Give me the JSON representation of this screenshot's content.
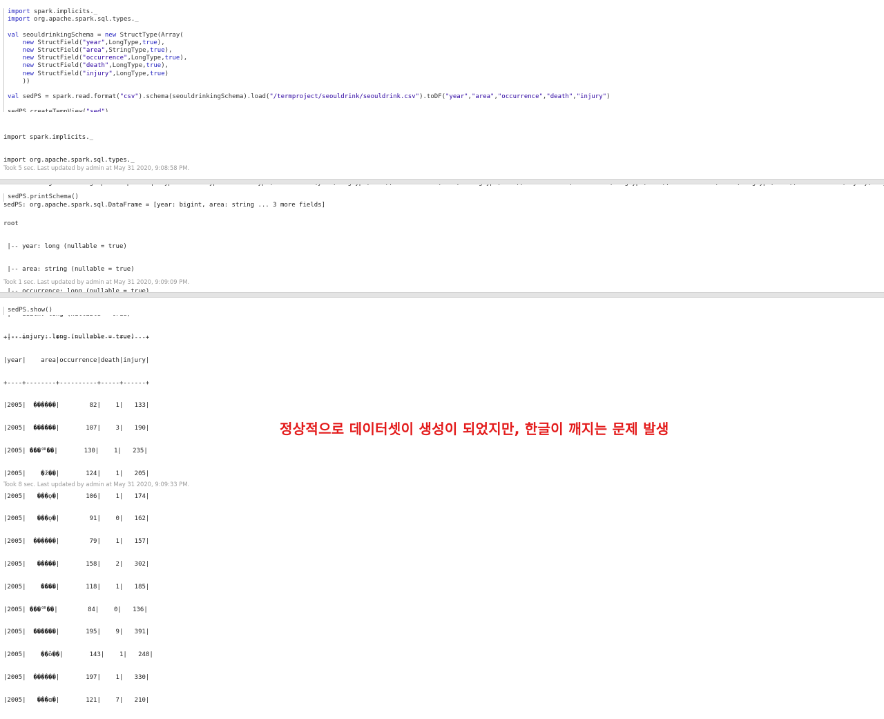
{
  "cell1": {
    "code_lines": [
      "import spark.implicits._",
      "import org.apache.spark.sql.types._",
      "",
      "val seouldrinkingSchema = new StructType(Array(",
      "    new StructField(\"year\",LongType,true),",
      "    new StructField(\"area\",StringType,true),",
      "    new StructField(\"occurrence\",LongType,true),",
      "    new StructField(\"death\",LongType,true),",
      "    new StructField(\"injury\",LongType,true)",
      "    ))",
      "",
      "val sedPS = spark.read.format(\"csv\").schema(seouldrinkingSchema).load(\"/termproject/seouldrink/seouldrink.csv\").toDF(\"year\",\"area\",\"occurrence\",\"death\",\"injury\")",
      "",
      "sedPS.createTempView(\"sed\")"
    ],
    "output_lines": [
      "import spark.implicits._",
      "import org.apache.spark.sql.types._",
      "seouldrinkingSchema: org.apache.spark.sql.types.StructType = StructType(StructField(year,LongType,true), StructField(area,StringType,true), StructField(occurrence,LongType,true), StructField(death,LongType,true), StructField(injury,LongType,true))",
      "sedPS: org.apache.spark.sql.DataFrame = [year: bigint, area: string ... 3 more fields]"
    ],
    "meta": "Took 5 sec. Last updated by admin at May 31 2020, 9:08:58 PM."
  },
  "cell2": {
    "code": "sedPS.printSchema()",
    "output_lines": [
      "root",
      " |-- year: long (nullable = true)",
      " |-- area: string (nullable = true)",
      " |-- occurrence: long (nullable = true)",
      " |-- death: long (nullable = true)",
      " |-- injury: long (nullable = true)"
    ],
    "meta": "Took 1 sec. Last updated by admin at May 31 2020, 9:09:09 PM."
  },
  "cell3": {
    "code": "sedPS.show()",
    "output_lines": [
      "+----+--------+----------+-----+------+",
      "|year|    area|occurrence|death|injury|",
      "+----+--------+----------+-----+------+",
      "|2005|  ������|        82|    1|   133|",
      "|2005|  ������|       107|    3|   190|",
      "|2005| ���ᅋ��|       130|    1|   235|",
      "|2005|    �ž��|       124|    1|   205|",
      "|2005|   ���ǫ�|       106|    1|   174|",
      "|2005|   ���ǫ�|        91|    0|   162|",
      "|2005|  ������|        79|    1|   157|",
      "|2005|   �����|       158|    2|   302|",
      "|2005|    ����|       118|    1|   185|",
      "|2005| ���ᅋ��|        84|    0|   136|",
      "|2005|  ������|       195|    9|   391|",
      "|2005|    ��ŏ��|       143|    1|   248|",
      "|2005|  ������|       197|    1|   330|",
      "|2005|   ���ɑ�|       121|    7|   210|"
    ],
    "meta": "Took 8 sec. Last updated by admin at May 31 2020, 9:09:33 PM."
  },
  "annotation": "정상적으로 데이터셋이 생성이 되었지만, 한글이 깨지는 문제 발생",
  "colors": {
    "annotation": "#e31a1a",
    "keyword": "#1f1fbf",
    "meta_text": "#9a9a9a",
    "separator": "#e4e4e4"
  }
}
